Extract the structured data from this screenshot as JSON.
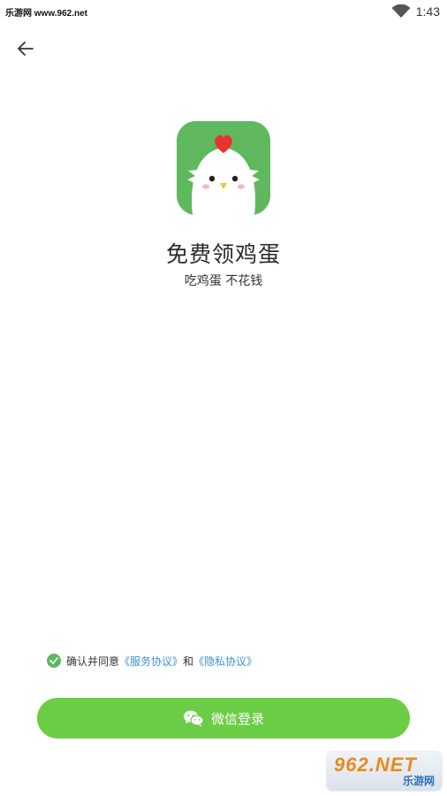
{
  "status_bar": {
    "watermark": "乐游网 www.962.net",
    "time": "1:43"
  },
  "nav": {
    "back_icon": "arrow-left-icon"
  },
  "app": {
    "icon": "chicken-app-icon",
    "title": "免费领鸡蛋",
    "subtitle": "吃鸡蛋 不花钱"
  },
  "agreement": {
    "checked": true,
    "prefix": "确认并同意",
    "service_link": "《服务协议》",
    "conjunction": "和",
    "privacy_link": "《隐私协议》"
  },
  "login_button": {
    "icon": "wechat-icon",
    "label": "微信登录"
  },
  "corner_watermark": {
    "brand": "962.NET",
    "name": "乐游网"
  },
  "colors": {
    "brand_green": "#6bcd46",
    "icon_green": "#5fb85e",
    "link_blue": "#3d8fd8"
  }
}
